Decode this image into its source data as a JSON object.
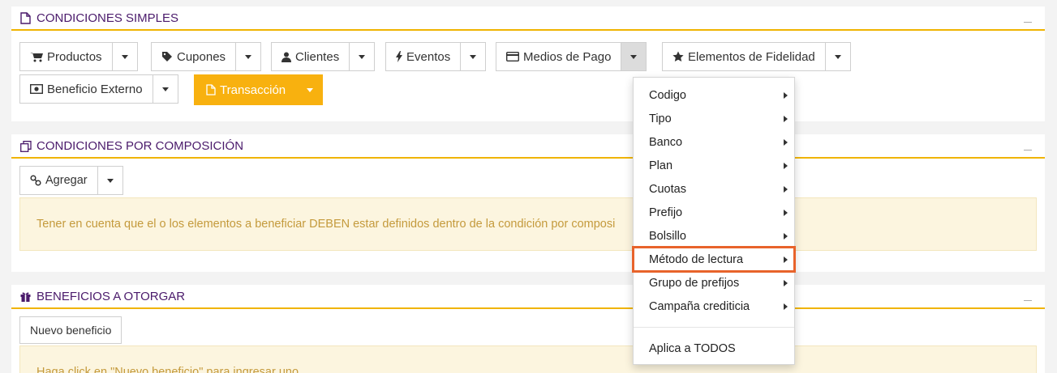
{
  "simple": {
    "title": "CONDICIONES SIMPLES",
    "buttons": [
      {
        "label": "Productos"
      },
      {
        "label": "Cupones"
      },
      {
        "label": "Clientes"
      },
      {
        "label": "Eventos"
      },
      {
        "label": "Medios de Pago"
      },
      {
        "label": "Elementos de Fidelidad"
      },
      {
        "label": "Beneficio Externo"
      },
      {
        "label": "Transacción"
      }
    ]
  },
  "composition": {
    "title": "CONDICIONES POR COMPOSICIÓN",
    "add_label": "Agregar",
    "notice": "Tener en cuenta que el o los elementos a beneficiar DEBEN estar definidos dentro de la condición por composi"
  },
  "benefits": {
    "title": "BENEFICIOS A OTORGAR",
    "new_label": "Nuevo beneficio",
    "notice": "Haga click en \"Nuevo beneficio\" para ingresar uno."
  },
  "menu": {
    "items": [
      {
        "label": "Codigo"
      },
      {
        "label": "Tipo"
      },
      {
        "label": "Banco"
      },
      {
        "label": "Plan"
      },
      {
        "label": "Cuotas"
      },
      {
        "label": "Prefijo"
      },
      {
        "label": "Bolsillo"
      },
      {
        "label": "Método de lectura"
      },
      {
        "label": "Grupo de prefijos"
      },
      {
        "label": "Campaña crediticia"
      }
    ],
    "apply_all": "Aplica a TODOS",
    "highlighted_index": 7
  },
  "colors": {
    "accent": "#f0b400",
    "title": "#4a1a6b",
    "highlight": "#e8632b",
    "transaction_button": "#f8b10f"
  }
}
